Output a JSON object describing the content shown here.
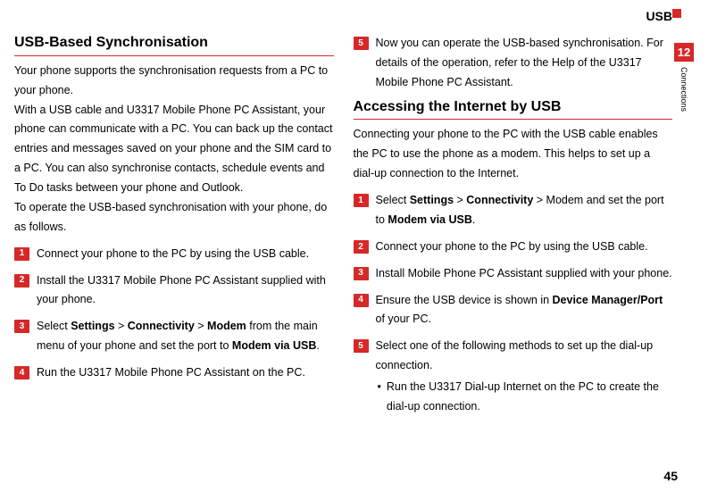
{
  "header": {
    "running_head": "USB"
  },
  "sidetab": {
    "chapter_num": "12",
    "chapter_label": "Connections"
  },
  "footer": {
    "page_number": "45"
  },
  "left": {
    "title": "USB-Based Synchronisation",
    "p1": "Your phone supports the synchronisation requests from a PC to your phone.",
    "p2": "With a USB cable and U3317 Mobile Phone PC Assistant, your phone can communicate with a PC. You can back up the contact entries and messages saved on your phone and the SIM card to a PC. You can also synchronise contacts, schedule events and To Do tasks between your phone and Outlook.",
    "p3": "To operate the USB-based synchronisation with your phone, do as follows.",
    "steps": {
      "s1": "Connect your phone to the PC by using the USB cable.",
      "s2": "Install the U3317 Mobile Phone PC Assistant supplied with your phone.",
      "s3_a": "Select ",
      "s3_b1": "Settings",
      "s3_gt1": " > ",
      "s3_b2": "Connectivity",
      "s3_gt2": " > ",
      "s3_b3": "Modem",
      "s3_c": " from the main menu of your phone and set the port to ",
      "s3_b4": "Modem via USB",
      "s3_end": ".",
      "s4": "Run the U3317 Mobile Phone PC Assistant on the PC."
    }
  },
  "right": {
    "cont_step5": "Now you can operate the USB-based synchronisation. For details of the operation, refer to the Help of the U3317 Mobile Phone PC Assistant.",
    "title": "Accessing the Internet by USB",
    "p1": "Connecting your phone to the PC with the USB cable enables the PC to use the phone as a modem. This helps to set up a dial-up connection to the Internet.",
    "steps": {
      "s1_a": "Select ",
      "s1_b1": "Settings",
      "s1_gt1": " > ",
      "s1_b2": "Connectivity",
      "s1_gt2": " > Modem and set the port to ",
      "s1_b3": "Modem via USB",
      "s1_end": ".",
      "s2": "Connect your phone to the PC by using the USB cable.",
      "s3": "Install Mobile Phone PC Assistant supplied with your phone.",
      "s4_a": "Ensure the USB device is shown in ",
      "s4_b": "Device Manager/Port",
      "s4_c": " of your PC.",
      "s5": "Select one of the following methods to set up the dial-up connection.",
      "s5_sub1": "Run the U3317 Dial-up Internet on the PC to create the dial-up connection."
    }
  },
  "badges": {
    "n1": "1",
    "n2": "2",
    "n3": "3",
    "n4": "4",
    "n5": "5"
  },
  "bullet": "•"
}
